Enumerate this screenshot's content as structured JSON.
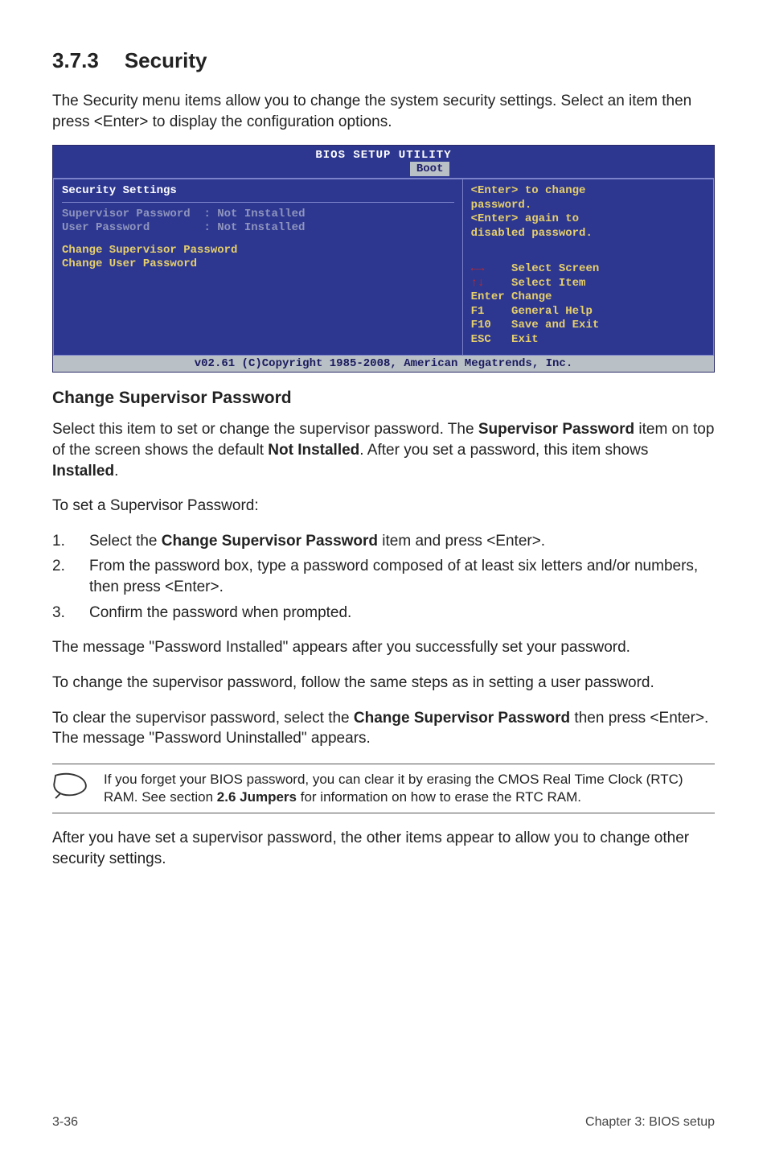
{
  "heading": {
    "number": "3.7.3",
    "title": "Security"
  },
  "intro": "The Security menu items allow you to change the system security settings. Select an item then press <Enter> to display the configuration options.",
  "bios": {
    "title": "BIOS SETUP UTILITY",
    "tab": "Boot",
    "left": {
      "header": "Security Settings",
      "rows": [
        {
          "label": "Supervisor Password",
          "value": ": Not Installed"
        },
        {
          "label": "User Password",
          "value": ": Not Installed"
        }
      ],
      "actions": [
        "Change Supervisor Password",
        "Change User Password"
      ]
    },
    "right": {
      "help": [
        "<Enter> to change",
        "password.",
        "<Enter> again to",
        "disabled password."
      ],
      "nav": {
        "lr": "Select Screen",
        "ud": "Select Item",
        "enter": "Change",
        "f1": "General Help",
        "f10": "Save and Exit",
        "esc": "Exit"
      }
    },
    "footer": "v02.61 (C)Copyright 1985-2008, American Megatrends, Inc."
  },
  "subhead": "Change Supervisor Password",
  "para1_a": "Select this item to set or change the supervisor password. The ",
  "para1_b": "Supervisor Password",
  "para1_c": " item on top of the screen shows the default ",
  "para1_d": "Not Installed",
  "para1_e": ". After you set a password, this item shows ",
  "para1_f": "Installed",
  "para1_g": ".",
  "para2": "To set a Supervisor Password:",
  "steps": [
    {
      "n": "1.",
      "t_a": "Select the ",
      "t_b": "Change Supervisor Password",
      "t_c": " item and press <Enter>."
    },
    {
      "n": "2.",
      "t_a": "From the password box, type a password composed of at least six letters and/or numbers, then press <Enter>.",
      "t_b": "",
      "t_c": ""
    },
    {
      "n": "3.",
      "t_a": "Confirm the password when prompted.",
      "t_b": "",
      "t_c": ""
    }
  ],
  "para3": "The message \"Password Installed\" appears after you successfully set your password.",
  "para4": "To change the supervisor password, follow the same steps as in setting a user password.",
  "para5_a": "To clear the supervisor password, select the ",
  "para5_b": "Change Supervisor Password",
  "para5_c": " then press <Enter>. The message \"Password Uninstalled\" appears.",
  "note_a": "If you forget your BIOS password, you can clear it by erasing the CMOS Real Time Clock (RTC) RAM. See section ",
  "note_b": "2.6 Jumpers",
  "note_c": " for information on how to erase the RTC RAM.",
  "para6": "After you have set a supervisor password, the other items appear to allow you to change other security settings.",
  "footer": {
    "left": "3-36",
    "right": "Chapter 3: BIOS setup"
  }
}
